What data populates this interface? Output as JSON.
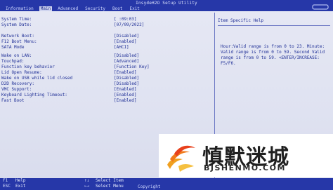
{
  "utility_title": "InsydeH2O Setup Utility",
  "tabs": [
    "Information",
    "Main",
    "Advanced",
    "Security",
    "Boot",
    "Exit"
  ],
  "active_tab": "Main",
  "settings": [
    {
      "label": "System Time:",
      "value": "[ :09:03]"
    },
    {
      "label": "System Date:",
      "value": "[07/09/2022]"
    },
    {
      "label": "Network Boot:",
      "value": "[Disabled]"
    },
    {
      "label": "F12 Boot Menu:",
      "value": "[Enabled]"
    },
    {
      "label": "SATA Mode",
      "value": "[AHCI]"
    },
    {
      "label": "Wake on LAN:",
      "value": "[Disabled]"
    },
    {
      "label": "Touchpad:",
      "value": "[Advanced]"
    },
    {
      "label": "Function key behavior",
      "value": "[Function Key]"
    },
    {
      "label": "Lid Open Resume:",
      "value": "[Enabled]"
    },
    {
      "label": "Wake on USB while lid closed",
      "value": "[Disabled]"
    },
    {
      "label": "D2D Recovery:",
      "value": "[Disabled]"
    },
    {
      "label": "VMC Support:",
      "value": "[Enabled]"
    },
    {
      "label": "Keyboard Lighting Timeout:",
      "value": "[Enabled]"
    },
    {
      "label": "Fast Boot",
      "value": "[Enabled]"
    }
  ],
  "help": {
    "title": "Item Specific Help",
    "text": "Hour:Valid range is from 0 to 23. Minute: Valid range is from 0 to 59. Second Valid range is from 0 to 59. <ENTER/INCREASE: F5/F6."
  },
  "footer": {
    "f1_key": "F1",
    "f1_label": "Help",
    "esc_key": "ESC",
    "esc_label": "Exit",
    "arrows_key": "↑↓",
    "arrows_label": "Select Item",
    "lr_key": "←→",
    "lr_label": "Select Menu",
    "copyright": "Copyright"
  },
  "watermark": {
    "name": "慎默迷城",
    "url": "BJSHENMO.COM"
  }
}
